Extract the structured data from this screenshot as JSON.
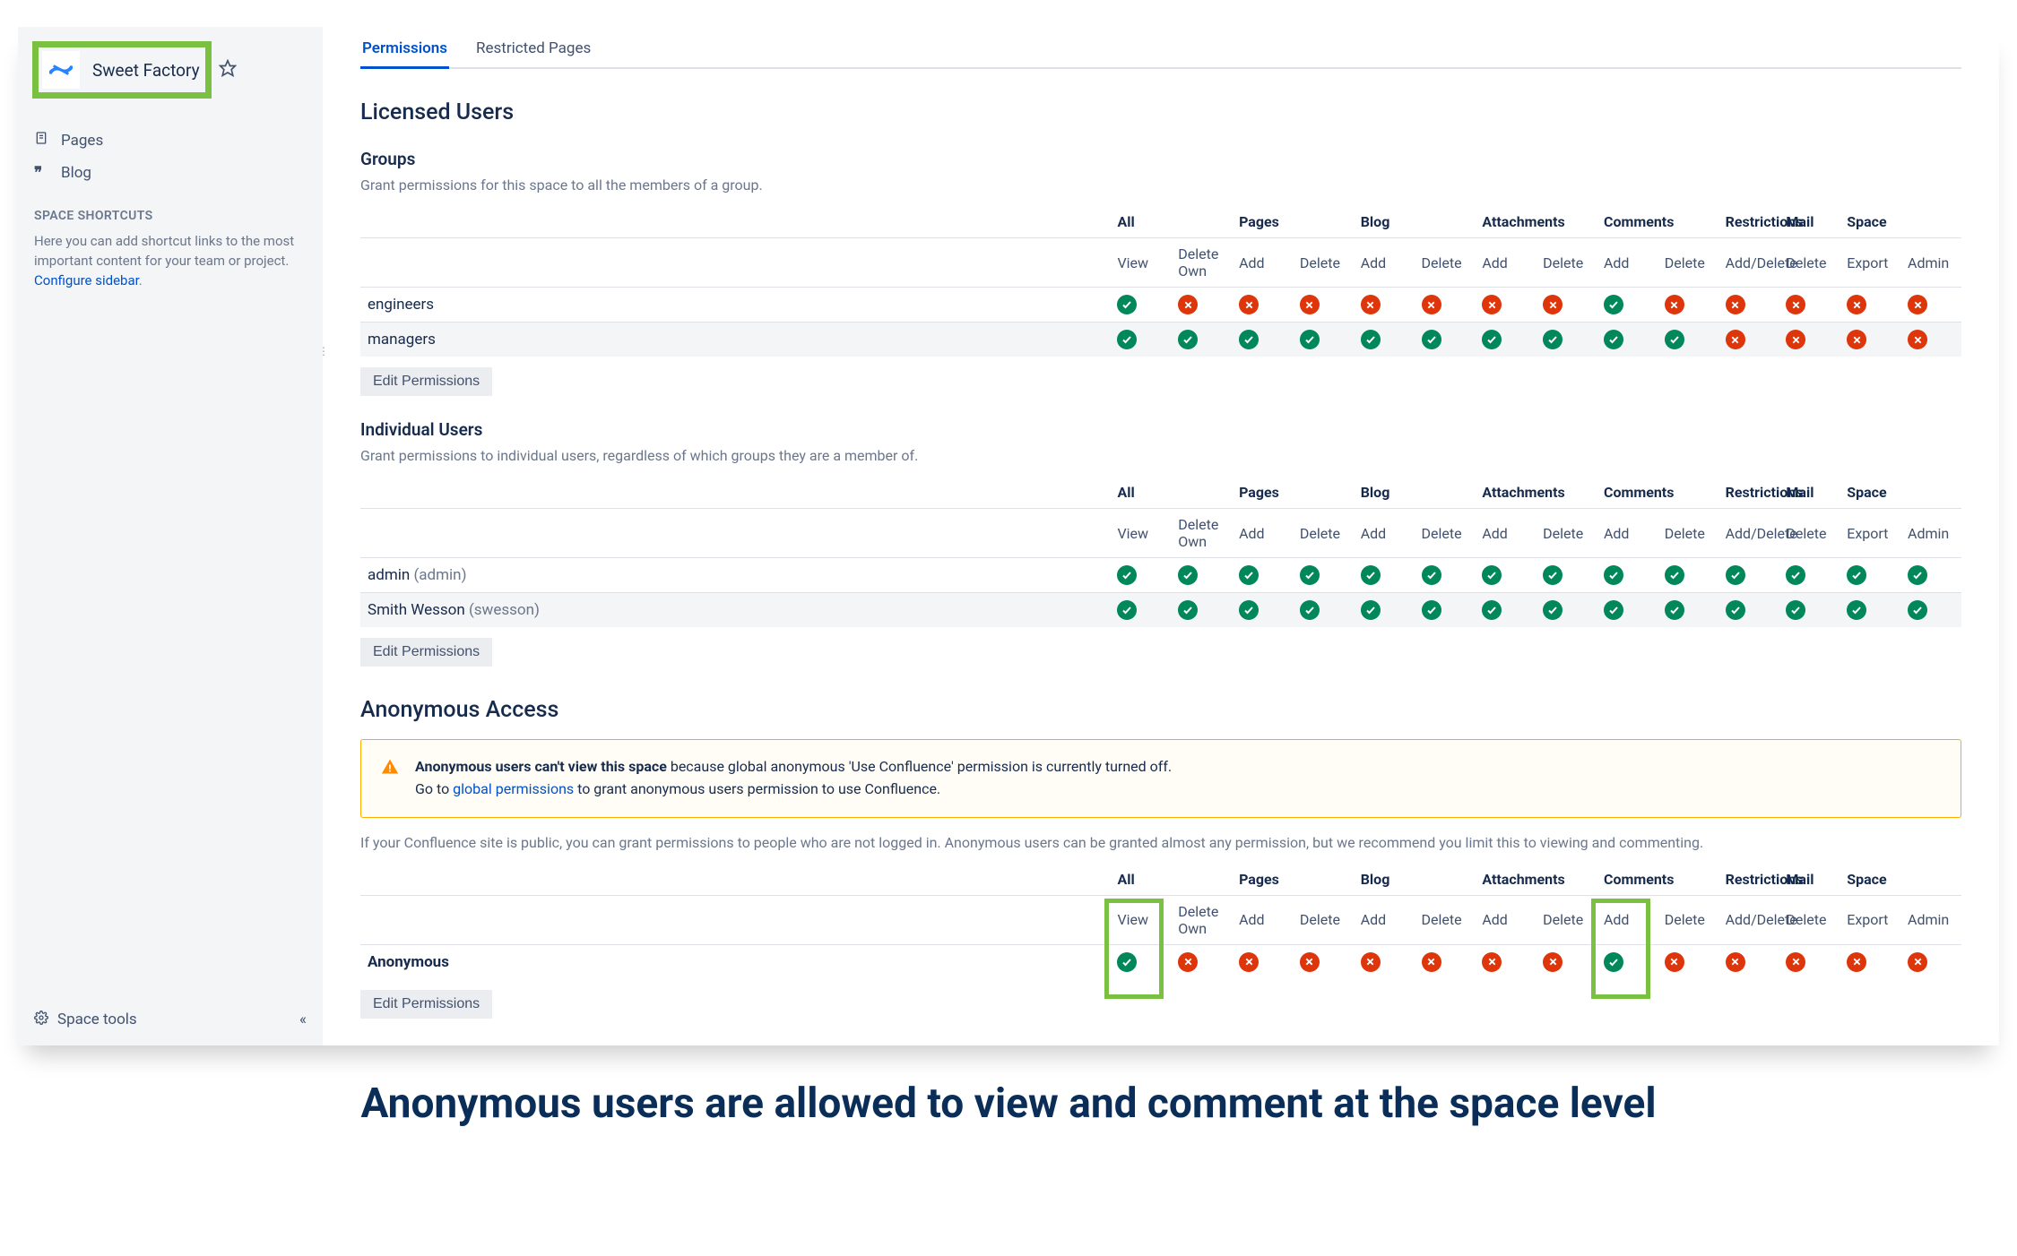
{
  "sidebar": {
    "space_name": "Sweet Factory",
    "nav": [
      {
        "icon": "page-icon",
        "label": "Pages"
      },
      {
        "icon": "quote-icon",
        "label": "Blog"
      }
    ],
    "shortcuts_label": "SPACE SHORTCUTS",
    "shortcuts_help": "Here you can add shortcut links to the most important content for your team or project.",
    "configure_link": "Configure sidebar",
    "footer_label": "Space tools"
  },
  "tabs": [
    {
      "label": "Permissions",
      "active": true
    },
    {
      "label": "Restricted Pages",
      "active": false
    }
  ],
  "perm_model": {
    "group_headers": [
      "All",
      "Pages",
      "Blog",
      "Attachments",
      "Comments",
      "Restrictions",
      "Mail",
      "Space"
    ],
    "group_spans": [
      2,
      2,
      2,
      2,
      2,
      1,
      1,
      2
    ],
    "sub_headers": [
      "View",
      "Delete Own",
      "Add",
      "Delete",
      "Add",
      "Delete",
      "Add",
      "Delete",
      "Add",
      "Delete",
      "Add/Delete",
      "Delete",
      "Export",
      "Admin"
    ]
  },
  "licensed_heading": "Licensed Users",
  "groups_section": {
    "heading": "Groups",
    "desc": "Grant permissions for this space to all the members of a group.",
    "rows": [
      {
        "label": "engineers",
        "perms": [
          true,
          false,
          false,
          false,
          false,
          false,
          false,
          false,
          true,
          false,
          false,
          false,
          false,
          false
        ]
      },
      {
        "label": "managers",
        "perms": [
          true,
          true,
          true,
          true,
          true,
          true,
          true,
          true,
          true,
          true,
          false,
          false,
          false,
          false
        ]
      }
    ],
    "edit_label": "Edit Permissions"
  },
  "users_section": {
    "heading": "Individual Users",
    "desc": "Grant permissions to individual users, regardless of which groups they are a member of.",
    "rows": [
      {
        "label": "admin",
        "paren": "(admin)",
        "perms": [
          true,
          true,
          true,
          true,
          true,
          true,
          true,
          true,
          true,
          true,
          true,
          true,
          true,
          true
        ]
      },
      {
        "label": "Smith Wesson",
        "paren": "(swesson)",
        "perms": [
          true,
          true,
          true,
          true,
          true,
          true,
          true,
          true,
          true,
          true,
          true,
          true,
          true,
          true
        ]
      }
    ],
    "edit_label": "Edit Permissions"
  },
  "anon_section": {
    "heading": "Anonymous Access",
    "warning_strong": "Anonymous users can't view this space",
    "warning_rest": " because global anonymous 'Use Confluence' permission is currently turned off.",
    "warning_line2_a": "Go to ",
    "warning_link": "global permissions",
    "warning_line2_b": " to grant anonymous users permission to use Confluence.",
    "desc": "If your Confluence site is public, you can grant permissions to people who are not logged in. Anonymous users can be granted almost any permission, but we recommend you limit this to viewing and commenting.",
    "row_label": "Anonymous",
    "perms": [
      true,
      false,
      false,
      false,
      false,
      false,
      false,
      false,
      true,
      false,
      false,
      false,
      false,
      false
    ],
    "highlighted": [
      0,
      8
    ],
    "edit_label": "Edit Permissions"
  },
  "caption": "Anonymous users are allowed to view and comment at the space level"
}
